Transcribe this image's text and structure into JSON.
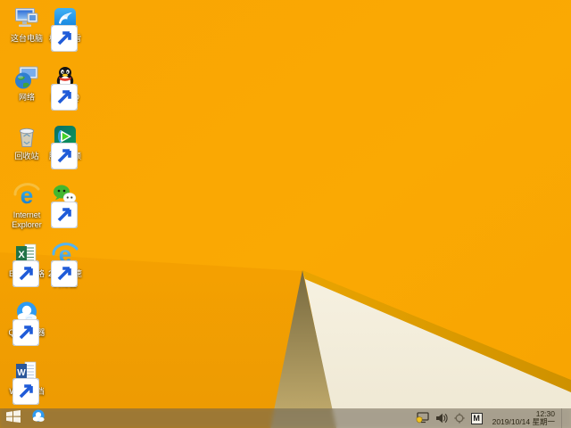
{
  "wallpaper": {
    "name": "windows-8.1-default-orange",
    "colors": {
      "orange": "#F9A602",
      "orange_deep": "#EC9A02",
      "gold_edge": "#DD9A01",
      "cream_wedge": "#F3EEDC",
      "shadow_tan": "#BFA867"
    }
  },
  "desktop": {
    "icons": [
      {
        "id": "this-pc",
        "label": "这台电脑",
        "shortcut": false
      },
      {
        "id": "thunder",
        "label": "极速迅雷",
        "shortcut": true
      },
      {
        "id": "network",
        "label": "网络",
        "shortcut": false
      },
      {
        "id": "tencent-qq",
        "label": "腾讯QQ",
        "shortcut": true
      },
      {
        "id": "recycle-bin",
        "label": "回收站",
        "shortcut": false
      },
      {
        "id": "tencent-video",
        "label": "腾讯视频",
        "shortcut": true
      },
      {
        "id": "internet-explorer",
        "label": "Internet Explorer",
        "shortcut": false
      },
      {
        "id": "wechat",
        "label": "微信",
        "shortcut": true
      },
      {
        "id": "excel",
        "label": "Excel表格",
        "shortcut": true
      },
      {
        "id": "browser-2345",
        "label": "2345加速浏览器",
        "shortcut": true
      },
      {
        "id": "qq-browser",
        "label": "QQ浏览器",
        "shortcut": true
      },
      {
        "id": "word",
        "label": "Word文档",
        "shortcut": true
      }
    ]
  },
  "taskbar": {
    "pinned": [
      {
        "id": "qq-browser",
        "label": "QQ浏览器"
      }
    ],
    "tray": {
      "icons": [
        "hidden-icons-expander",
        "pc-security",
        "volume",
        "compass-indicator",
        "ime-mode"
      ],
      "ime_label": "M",
      "clock": {
        "time": "12:30",
        "date": "2019/10/14 星期一"
      }
    }
  }
}
